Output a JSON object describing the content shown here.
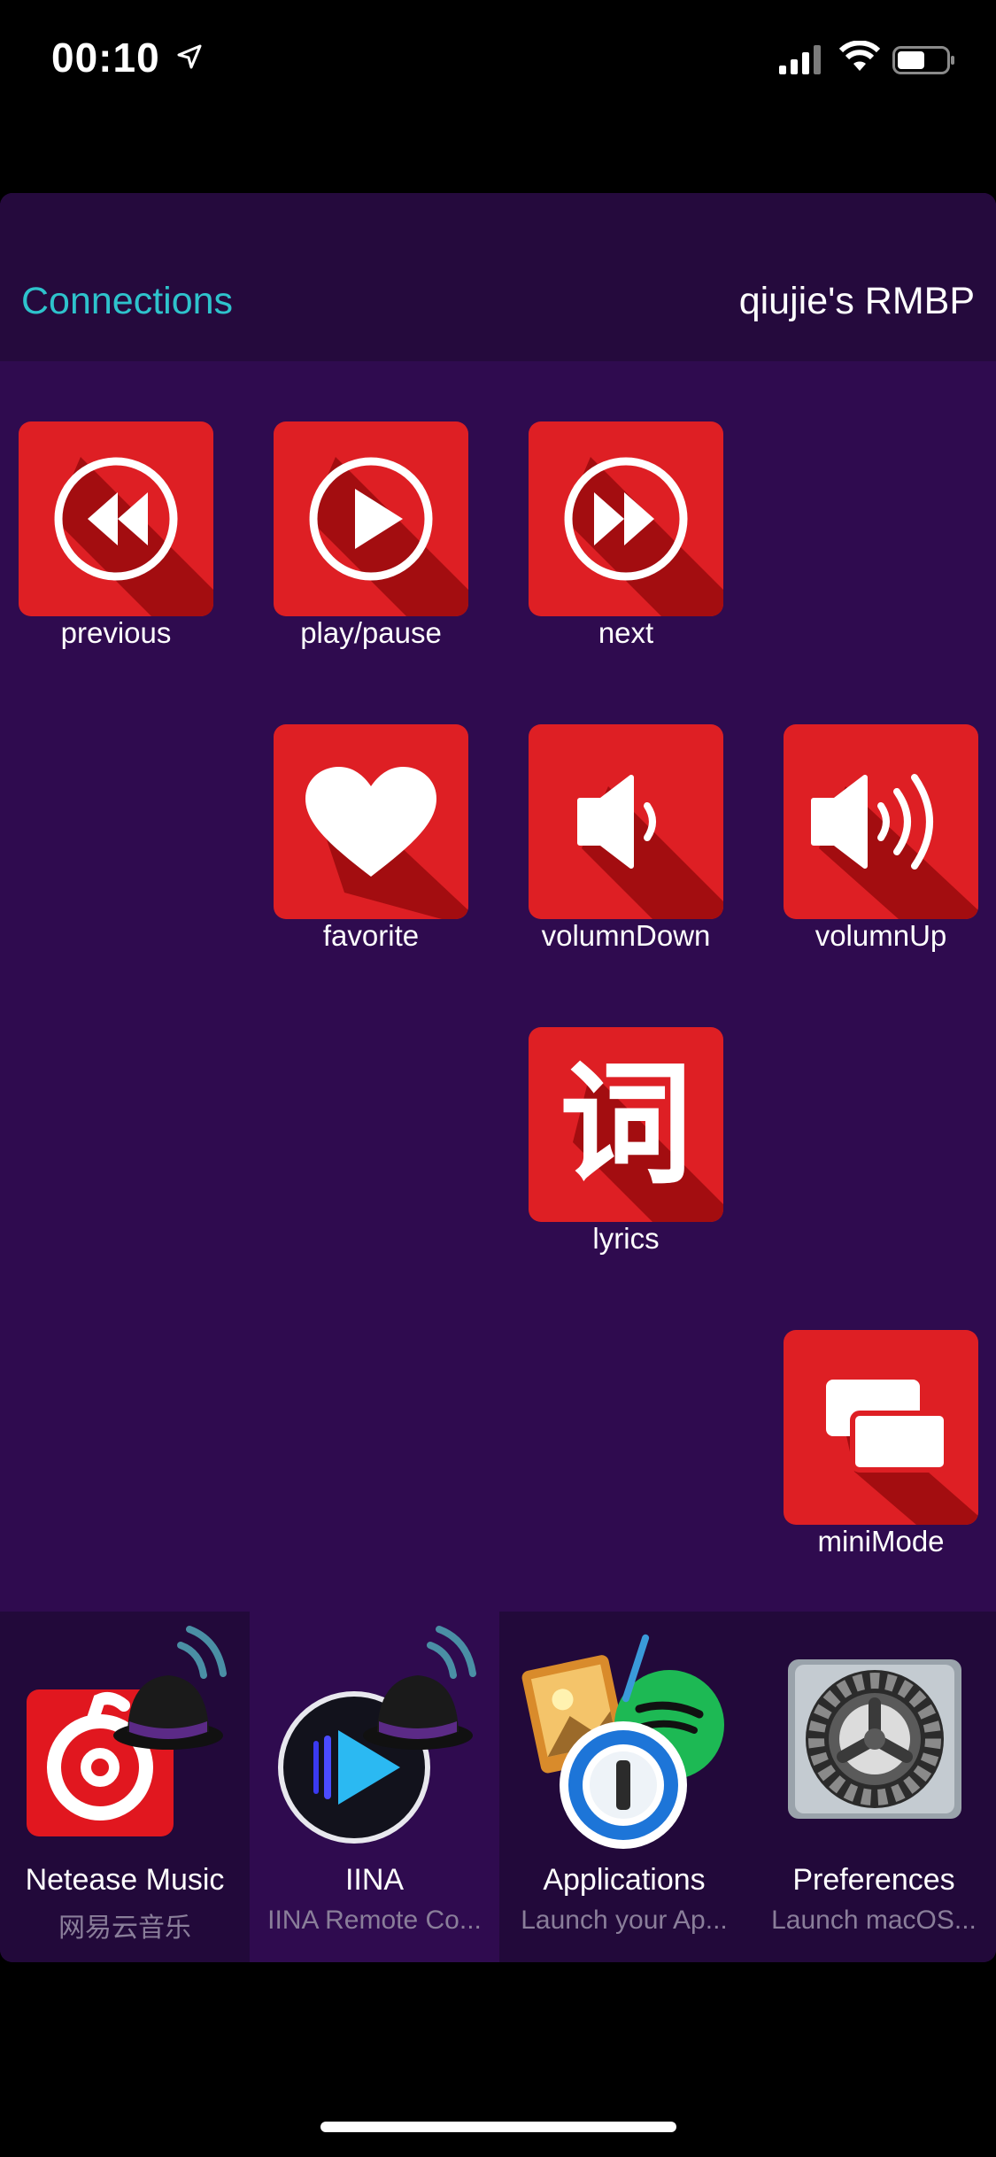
{
  "status_bar": {
    "time": "00:10"
  },
  "navbar": {
    "left": "Connections",
    "right": "qiujie's RMBP"
  },
  "controls": {
    "previous": "previous",
    "play_pause": "play/pause",
    "next": "next",
    "favorite": "favorite",
    "volume_down": "volumnDown",
    "volume_up": "volumnUp",
    "lyrics": "lyrics",
    "lyrics_glyph": "词",
    "mini_mode": "miniMode"
  },
  "dock": [
    {
      "title": "Netease Music",
      "subtitle": "网易云音乐"
    },
    {
      "title": "IINA",
      "subtitle": "IINA Remote Co..."
    },
    {
      "title": "Applications",
      "subtitle": "Launch your Ap..."
    },
    {
      "title": "Preferences",
      "subtitle": "Launch macOS..."
    }
  ],
  "colors": {
    "accent": "#2ec3cc",
    "button_red": "#de1f24",
    "background": "#2f0b4f"
  }
}
